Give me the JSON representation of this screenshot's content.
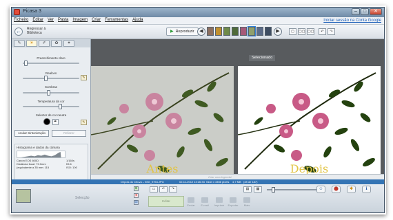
{
  "window": {
    "title": "Picasa 3"
  },
  "menubar": {
    "items": [
      "Ficheiro",
      "Editar",
      "Ver",
      "Pasta",
      "Imagem",
      "Criar",
      "Ferramentas",
      "Ajuda"
    ],
    "signin": "Iniciar sessão na Conta Google"
  },
  "toolbar": {
    "breadcrumb_line1": "Regressar à",
    "breadcrumb_line2": "Biblioteca",
    "play_label": "Reproduzir",
    "filmstrip_count": 8
  },
  "edit_panel": {
    "tabs": [
      "wrench-icon",
      "sun-icon",
      "brush-icon",
      "palette-icon",
      "effects-icon"
    ],
    "active_tab": 1,
    "fill_light_label": "Preenchimento claro",
    "highlights_label": "Realces",
    "shadows_label": "Sombras",
    "color_temp_label": "Temperatura da cor",
    "neutral_picker_label": "Selector de cor neutra",
    "fill_light_level": 0.02,
    "highlights_level": 0.4,
    "shadows_level": 0.45,
    "color_temp_level": 0.68,
    "undo_label": "Anular Sintonização",
    "redo_label": "Refazer",
    "histogram_title": "Histograma e dados da câmara",
    "exif": {
      "camera": "Canon EOS 600D",
      "focal": "Distância focal: 72.0mm",
      "equiv": "(equivalente a 35 mm: 115",
      "exposure": "1/160s",
      "fstop": "f/5.6",
      "iso": "ISO: 100"
    }
  },
  "viewer": {
    "selected_label": "Selecionado",
    "before_label": "Antes",
    "after_label": "Depois",
    "caption_placeholder": "Criar uma legenda!"
  },
  "status": {
    "filename": "Depois do Chuva – IMG_9754.JPG",
    "date": "02-11-2012 13:26:33",
    "resolution": "5184 x 3456 pixels",
    "size": "4,7 MB",
    "position": "(28 de 187)"
  },
  "bottom": {
    "tray_label": "Selecção",
    "actions": [
      "Editar",
      "Enviar",
      "E-mail",
      "Imprimir",
      "Exportar",
      "Mais"
    ],
    "zoom_level": 0.1
  }
}
